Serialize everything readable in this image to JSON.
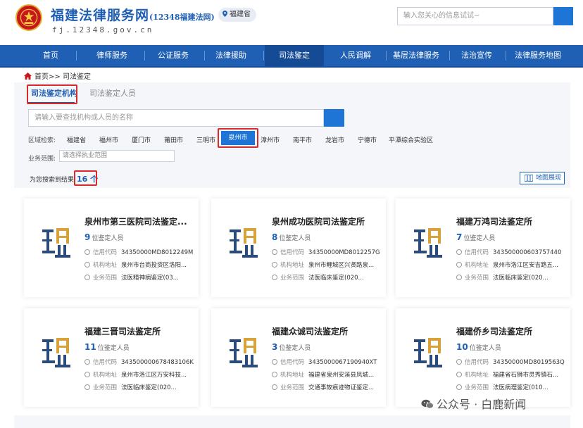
{
  "header": {
    "site_title": "福建法律服务网",
    "site_subtitle": "(12348福建法网)",
    "domain": "fj.12348.gov.cn",
    "region_chip": "福建省",
    "search_placeholder": "输入您关心的信息试试~"
  },
  "nav": {
    "items": [
      {
        "label": "首页"
      },
      {
        "label": "律师服务"
      },
      {
        "label": "公证服务"
      },
      {
        "label": "法律援助"
      },
      {
        "label": "司法鉴定"
      },
      {
        "label": "人民调解"
      },
      {
        "label": "基层法律服务"
      },
      {
        "label": "法治宣传"
      },
      {
        "label": "法律服务地图"
      }
    ],
    "active_index": 4
  },
  "breadcrumb": {
    "home": "首页",
    "separator": ">>",
    "current": "司法鉴定"
  },
  "tabs": [
    {
      "label": "司法鉴定机构",
      "active": true
    },
    {
      "label": "司法鉴定人员",
      "active": false
    }
  ],
  "search": {
    "placeholder": "请输入要查找机构或人员的名称"
  },
  "filters": {
    "region_label": "区域检索:",
    "regions": [
      "福建省",
      "福州市",
      "厦门市",
      "莆田市",
      "三明市",
      "泉州市",
      "漳州市",
      "南平市",
      "龙岩市",
      "宁德市",
      "平潭综合实验区"
    ],
    "active_region": "泉州市",
    "scope_label": "业务范围:",
    "scope_placeholder": "请选择执业范围"
  },
  "results": {
    "prefix": "为您搜索到结果",
    "count": "16 个",
    "map_button": "地图展现"
  },
  "card_labels": {
    "count_suffix": "位鉴定人员",
    "credit_code": "信用代码",
    "address": "机构地址",
    "scope": "业务范围"
  },
  "cards": [
    {
      "name": "泉州市第三医院司法鉴定...",
      "count": "9",
      "credit_code": "34350000MD8012249M",
      "address": "泉州市台商投资区洛阳...",
      "scope": "法医精神病鉴定(03..."
    },
    {
      "name": "泉州成功医院司法鉴定所",
      "count": "8",
      "credit_code": "34350000MD8012257G",
      "address": "泉州市鲤城区兴贤路泉...",
      "scope": "法医临床鉴定(020..."
    },
    {
      "name": "福建万鸿司法鉴定所",
      "count": "7",
      "credit_code": "343500000603757440",
      "address": "泉州市洛江区安吉路五...",
      "scope": "法医临床鉴定(020..."
    },
    {
      "name": "福建三晋司法鉴定所",
      "count": "11",
      "credit_code": "343500000678483106K",
      "address": "泉州市洛江区万安科技...",
      "scope": "法医临床鉴定(020..."
    },
    {
      "name": "福建众诚司法鉴定所",
      "count": "3",
      "credit_code": "3435000067190940XT",
      "address": "福建省泉州安溪县凤城...",
      "scope": "交通事故痕迹物证鉴定..."
    },
    {
      "name": "福建侨乡司法鉴定所",
      "count": "10",
      "credit_code": "34350000MD8019563Q",
      "address": "福建省石狮市灵秀镇石...",
      "scope": "法医病理鉴定(010..."
    }
  ],
  "watermark": "公众号 · 白鹿新闻",
  "colors": {
    "brand_blue": "#1f5fb4",
    "accent_blue": "#1f75d6",
    "highlight_red": "#d72b2b"
  }
}
